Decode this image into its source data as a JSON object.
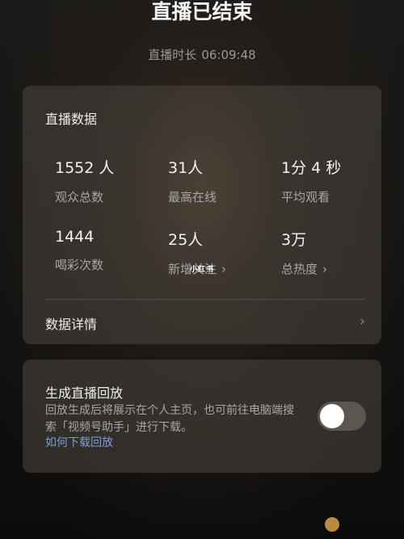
{
  "header": {
    "title": "直播已结束",
    "duration_label": "直播时长",
    "duration_value": "06:09:48"
  },
  "stats": {
    "title": "直播数据",
    "items": [
      {
        "value": "1552 人",
        "label": "观众总数"
      },
      {
        "value": "31人",
        "label": "最高在线"
      },
      {
        "value": "1分 4 秒",
        "label": "平均观看"
      },
      {
        "value": "1444",
        "label": "喝彩次数"
      },
      {
        "value": "25人",
        "label": "新增关注",
        "chevron": "›"
      },
      {
        "value": "3万",
        "label": "总热度",
        "chevron": "›"
      }
    ],
    "detail_label": "数据详情",
    "detail_chevron": "›"
  },
  "replay": {
    "title": "生成直播回放",
    "description": "回放生成后将展示在个人主页，也可前往电脑端搜索「视频号助手」进行下载。",
    "link": "如何下载回放",
    "toggle_on": false
  },
  "overlay": {
    "sticker_text": "小红书"
  },
  "colors": {
    "accent_link": "#7f9cd6",
    "card_bg": "rgba(70,64,58,0.62)",
    "toggle_off": "#5b5650"
  }
}
